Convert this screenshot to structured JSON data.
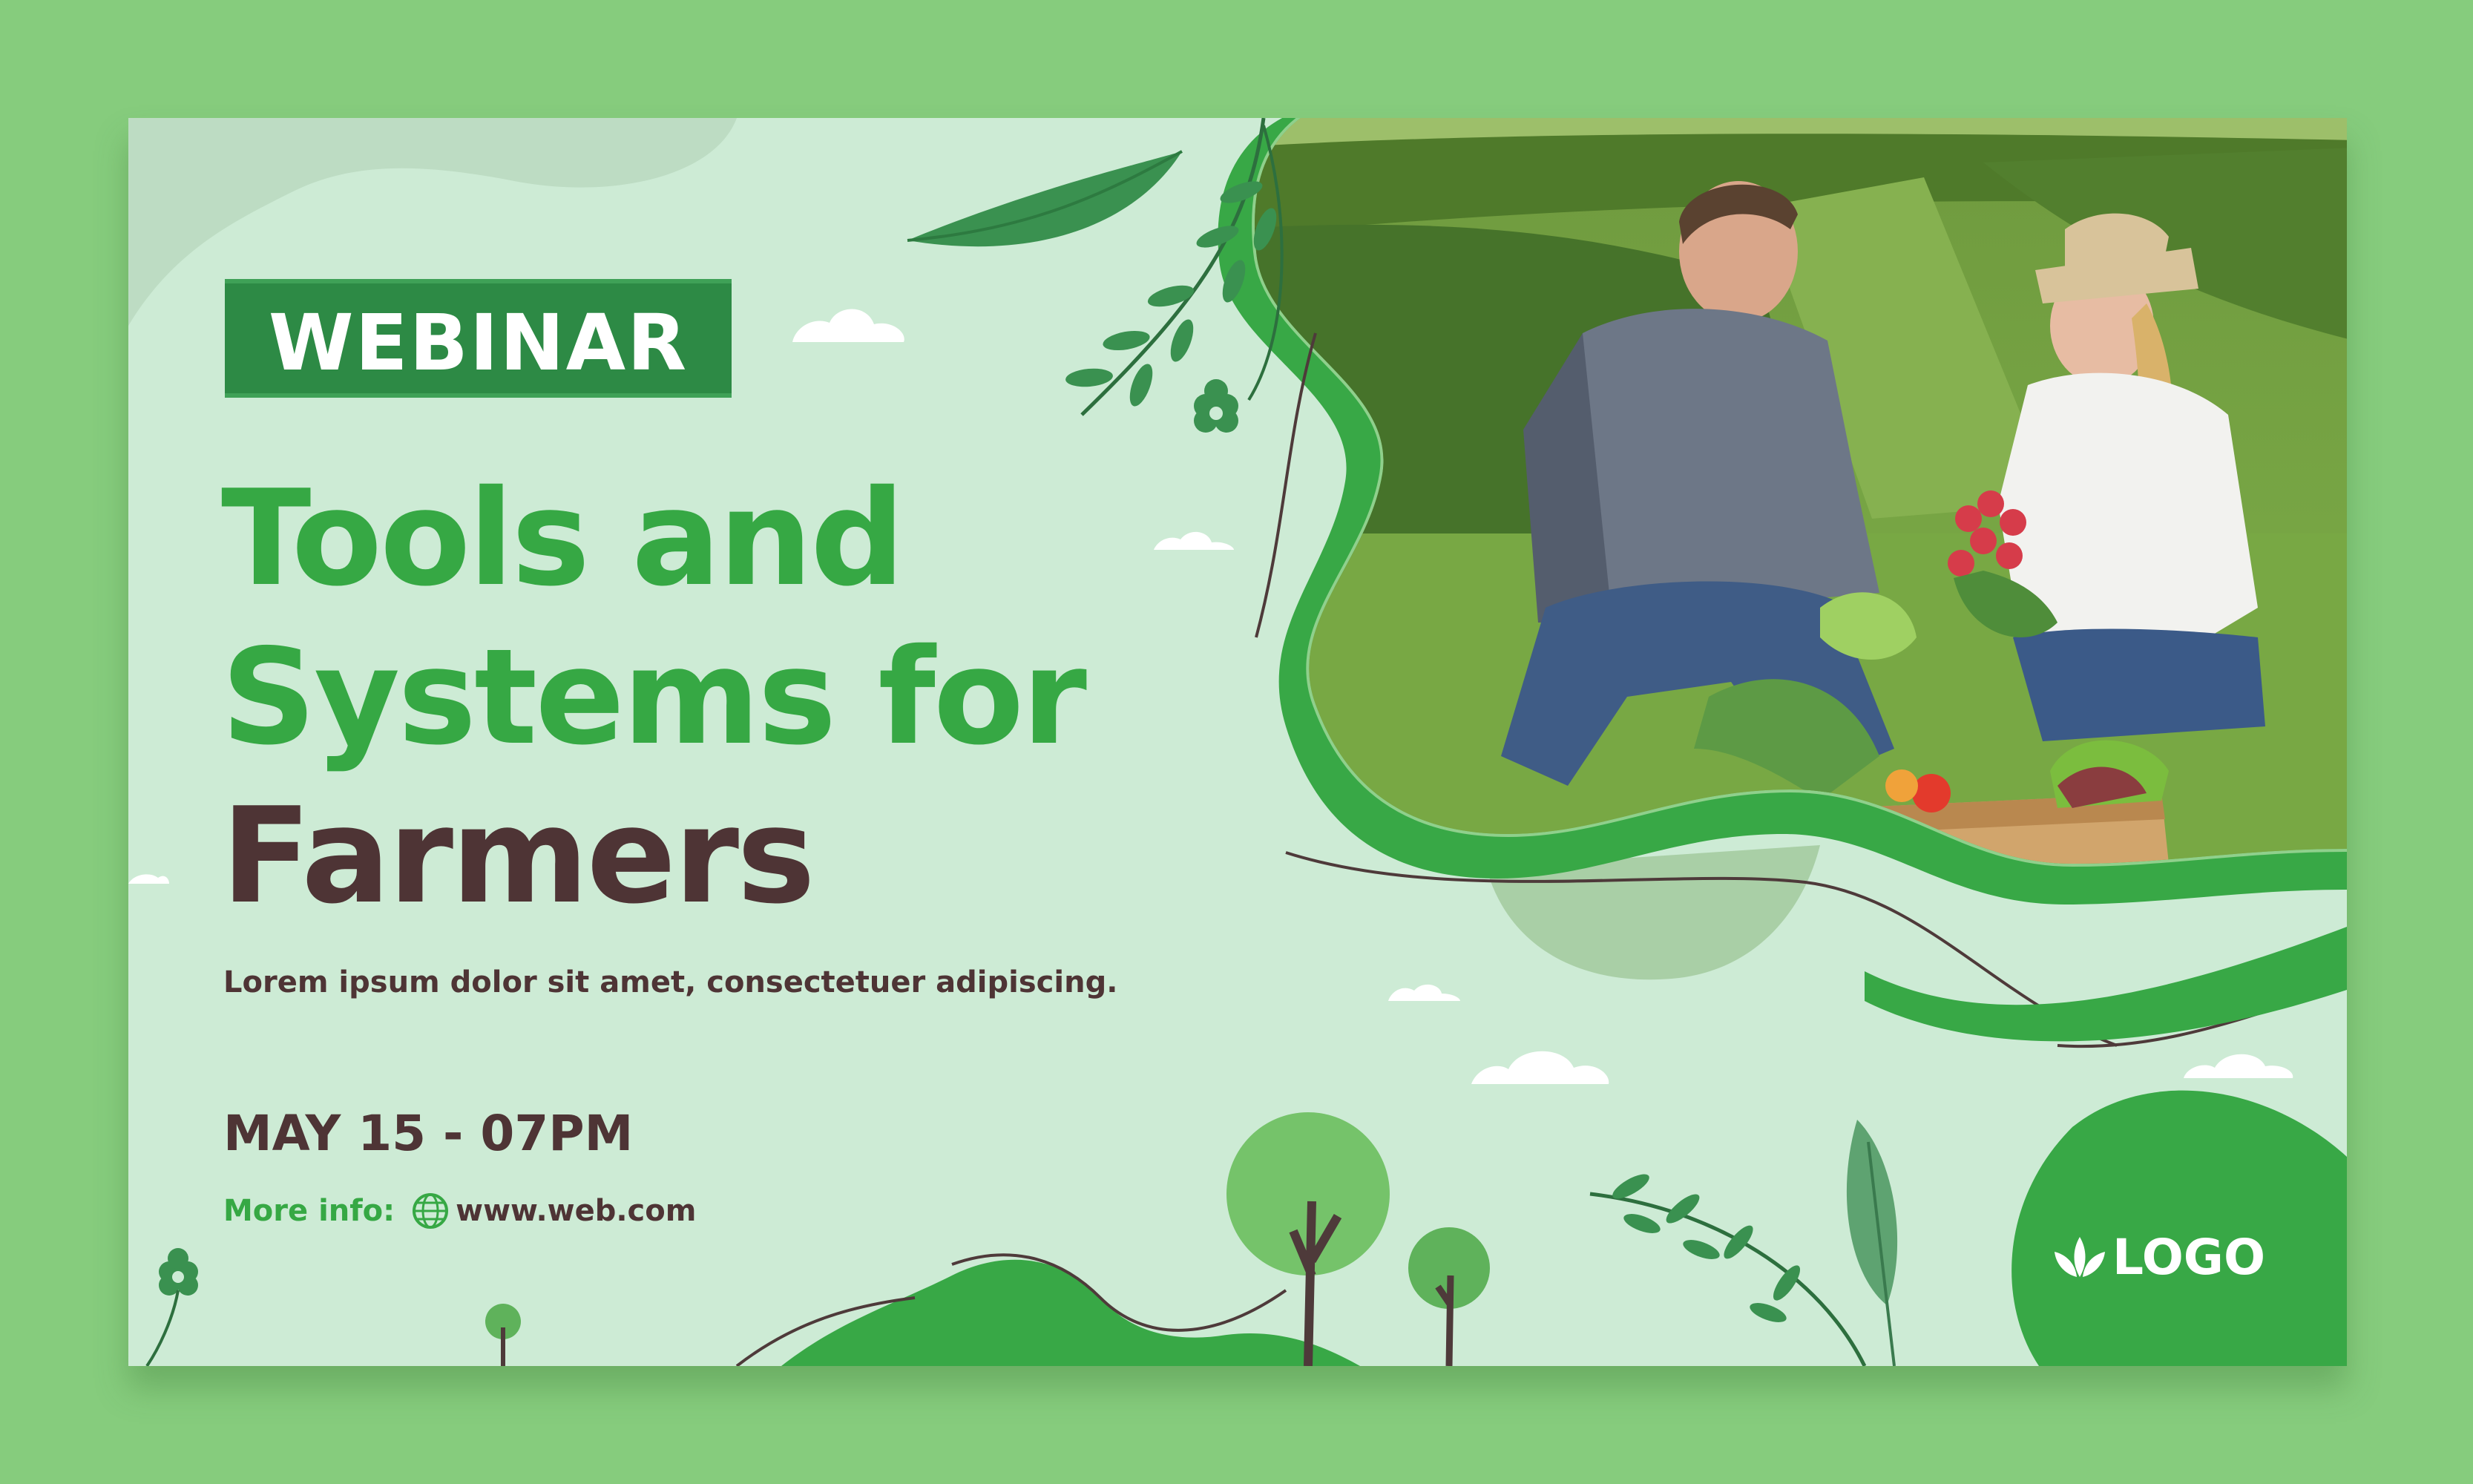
{
  "badge": "WEBINAR",
  "title": {
    "line1": "Tools and",
    "line2": "Systems for",
    "line3": "Farmers"
  },
  "subtitle": "Lorem ipsum dolor sit amet, consectetuer adipiscing.",
  "event": {
    "date": "MAY 15 - 07PM",
    "info_label": "More info:",
    "url": "www.web.com"
  },
  "logo_text": "LOGO",
  "icons": [
    "globe-icon",
    "leaf-logo-icon",
    "cloud-icon",
    "flower-icon",
    "tree-icon",
    "leaf-branch-icon"
  ],
  "photo": {
    "subject": "farmers-with-vegetable-crate"
  },
  "colors": {
    "page_background": "#86cc7d",
    "card_background": "#cdebd5",
    "accent_green": "#36a844",
    "dark_green": "#2d8a45",
    "text_brown": "#4e3435"
  }
}
